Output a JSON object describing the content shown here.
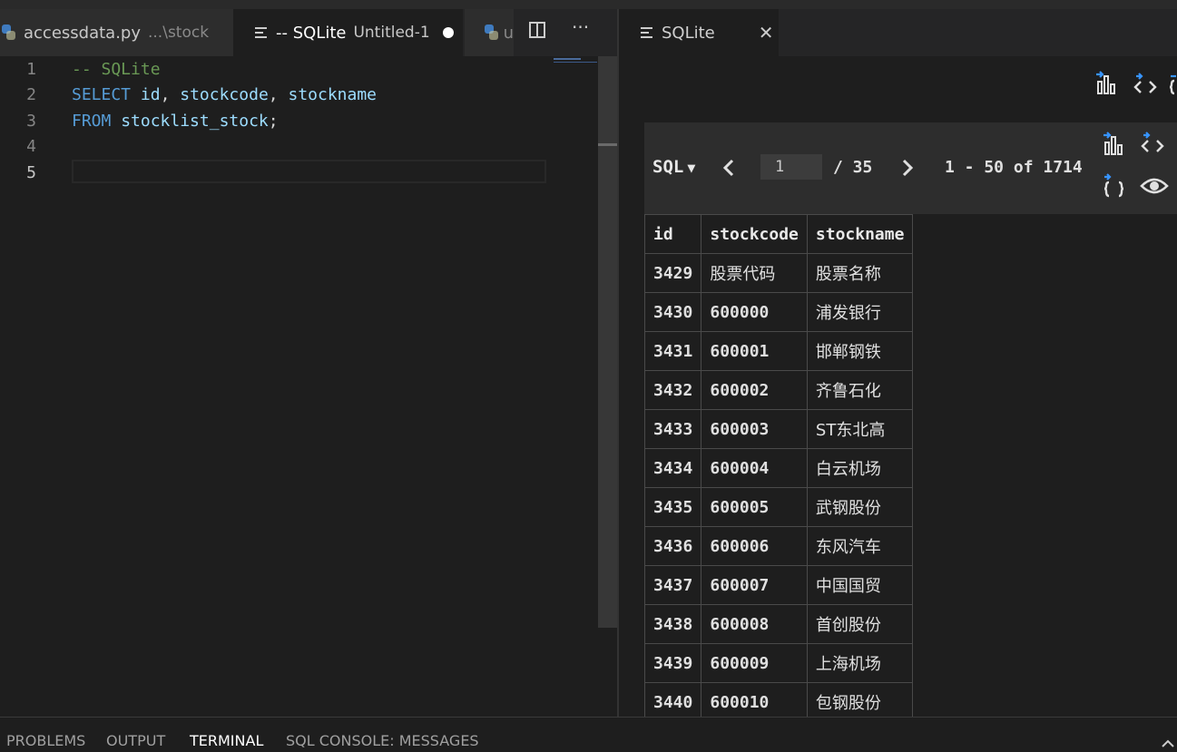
{
  "colors": {
    "accent": "#3794ff",
    "background": "#1e1e1e",
    "keyword": "#569cd6",
    "identifier": "#9cdcfe",
    "comment": "#6a9955"
  },
  "left_tabs": [
    {
      "label": "accessdata.py",
      "description": "...\\stock",
      "icon": "python-icon"
    },
    {
      "label": "-- SQLite",
      "description": "Untitled-1",
      "icon": "lines-icon",
      "dirty": true
    },
    {
      "label": "u",
      "icon": "python-icon"
    }
  ],
  "editor": {
    "lines": [
      {
        "num": "1",
        "tokens": [
          {
            "t": "-- SQLite",
            "c": "cm"
          }
        ]
      },
      {
        "num": "2",
        "tokens": [
          {
            "t": "SELECT",
            "c": "kw"
          },
          {
            "t": " ",
            "c": "pn"
          },
          {
            "t": "id",
            "c": "id"
          },
          {
            "t": ", ",
            "c": "pn"
          },
          {
            "t": "stockcode",
            "c": "id"
          },
          {
            "t": ", ",
            "c": "pn"
          },
          {
            "t": "stockname",
            "c": "id"
          }
        ]
      },
      {
        "num": "3",
        "tokens": [
          {
            "t": "FROM",
            "c": "kw"
          },
          {
            "t": " ",
            "c": "pn"
          },
          {
            "t": "stocklist_stock",
            "c": "id"
          },
          {
            "t": ";",
            "c": "pn"
          }
        ]
      },
      {
        "num": "4",
        "tokens": []
      },
      {
        "num": "5",
        "tokens": []
      }
    ],
    "current_line": "5"
  },
  "right_tab": {
    "label": "SQLite",
    "icon": "lines-icon"
  },
  "results": {
    "mode_label": "SQL",
    "page_value": "1",
    "page_total": "/ 35",
    "range_text": "1 - 50 of 1714",
    "columns": [
      "id",
      "stockcode",
      "stockname"
    ],
    "rows": [
      [
        "3429",
        "股票代码",
        "股票名称"
      ],
      [
        "3430",
        "600000",
        "浦发银行"
      ],
      [
        "3431",
        "600001",
        "邯郸钢铁"
      ],
      [
        "3432",
        "600002",
        "齐鲁石化"
      ],
      [
        "3433",
        "600003",
        "ST东北高"
      ],
      [
        "3434",
        "600004",
        "白云机场"
      ],
      [
        "3435",
        "600005",
        "武钢股份"
      ],
      [
        "3436",
        "600006",
        "东风汽车"
      ],
      [
        "3437",
        "600007",
        "中国国贸"
      ],
      [
        "3438",
        "600008",
        "首创股份"
      ],
      [
        "3439",
        "600009",
        "上海机场"
      ],
      [
        "3440",
        "600010",
        "包钢股份"
      ]
    ]
  },
  "panel_tabs": [
    "PROBLEMS",
    "OUTPUT",
    "TERMINAL",
    "SQL CONSOLE: MESSAGES"
  ],
  "panel_active": "TERMINAL"
}
